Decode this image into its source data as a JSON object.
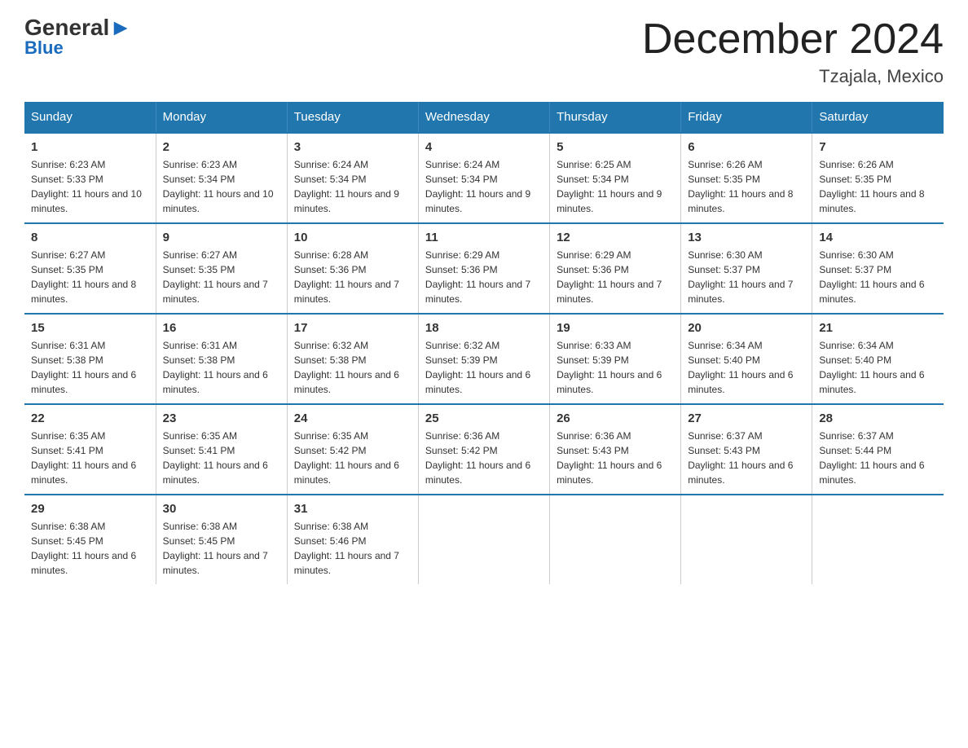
{
  "header": {
    "logo_general": "General",
    "logo_blue": "Blue",
    "title": "December 2024",
    "location": "Tzajala, Mexico"
  },
  "days_of_week": [
    "Sunday",
    "Monday",
    "Tuesday",
    "Wednesday",
    "Thursday",
    "Friday",
    "Saturday"
  ],
  "weeks": [
    [
      {
        "day": "1",
        "sunrise": "6:23 AM",
        "sunset": "5:33 PM",
        "daylight": "11 hours and 10 minutes."
      },
      {
        "day": "2",
        "sunrise": "6:23 AM",
        "sunset": "5:34 PM",
        "daylight": "11 hours and 10 minutes."
      },
      {
        "day": "3",
        "sunrise": "6:24 AM",
        "sunset": "5:34 PM",
        "daylight": "11 hours and 9 minutes."
      },
      {
        "day": "4",
        "sunrise": "6:24 AM",
        "sunset": "5:34 PM",
        "daylight": "11 hours and 9 minutes."
      },
      {
        "day": "5",
        "sunrise": "6:25 AM",
        "sunset": "5:34 PM",
        "daylight": "11 hours and 9 minutes."
      },
      {
        "day": "6",
        "sunrise": "6:26 AM",
        "sunset": "5:35 PM",
        "daylight": "11 hours and 8 minutes."
      },
      {
        "day": "7",
        "sunrise": "6:26 AM",
        "sunset": "5:35 PM",
        "daylight": "11 hours and 8 minutes."
      }
    ],
    [
      {
        "day": "8",
        "sunrise": "6:27 AM",
        "sunset": "5:35 PM",
        "daylight": "11 hours and 8 minutes."
      },
      {
        "day": "9",
        "sunrise": "6:27 AM",
        "sunset": "5:35 PM",
        "daylight": "11 hours and 7 minutes."
      },
      {
        "day": "10",
        "sunrise": "6:28 AM",
        "sunset": "5:36 PM",
        "daylight": "11 hours and 7 minutes."
      },
      {
        "day": "11",
        "sunrise": "6:29 AM",
        "sunset": "5:36 PM",
        "daylight": "11 hours and 7 minutes."
      },
      {
        "day": "12",
        "sunrise": "6:29 AM",
        "sunset": "5:36 PM",
        "daylight": "11 hours and 7 minutes."
      },
      {
        "day": "13",
        "sunrise": "6:30 AM",
        "sunset": "5:37 PM",
        "daylight": "11 hours and 7 minutes."
      },
      {
        "day": "14",
        "sunrise": "6:30 AM",
        "sunset": "5:37 PM",
        "daylight": "11 hours and 6 minutes."
      }
    ],
    [
      {
        "day": "15",
        "sunrise": "6:31 AM",
        "sunset": "5:38 PM",
        "daylight": "11 hours and 6 minutes."
      },
      {
        "day": "16",
        "sunrise": "6:31 AM",
        "sunset": "5:38 PM",
        "daylight": "11 hours and 6 minutes."
      },
      {
        "day": "17",
        "sunrise": "6:32 AM",
        "sunset": "5:38 PM",
        "daylight": "11 hours and 6 minutes."
      },
      {
        "day": "18",
        "sunrise": "6:32 AM",
        "sunset": "5:39 PM",
        "daylight": "11 hours and 6 minutes."
      },
      {
        "day": "19",
        "sunrise": "6:33 AM",
        "sunset": "5:39 PM",
        "daylight": "11 hours and 6 minutes."
      },
      {
        "day": "20",
        "sunrise": "6:34 AM",
        "sunset": "5:40 PM",
        "daylight": "11 hours and 6 minutes."
      },
      {
        "day": "21",
        "sunrise": "6:34 AM",
        "sunset": "5:40 PM",
        "daylight": "11 hours and 6 minutes."
      }
    ],
    [
      {
        "day": "22",
        "sunrise": "6:35 AM",
        "sunset": "5:41 PM",
        "daylight": "11 hours and 6 minutes."
      },
      {
        "day": "23",
        "sunrise": "6:35 AM",
        "sunset": "5:41 PM",
        "daylight": "11 hours and 6 minutes."
      },
      {
        "day": "24",
        "sunrise": "6:35 AM",
        "sunset": "5:42 PM",
        "daylight": "11 hours and 6 minutes."
      },
      {
        "day": "25",
        "sunrise": "6:36 AM",
        "sunset": "5:42 PM",
        "daylight": "11 hours and 6 minutes."
      },
      {
        "day": "26",
        "sunrise": "6:36 AM",
        "sunset": "5:43 PM",
        "daylight": "11 hours and 6 minutes."
      },
      {
        "day": "27",
        "sunrise": "6:37 AM",
        "sunset": "5:43 PM",
        "daylight": "11 hours and 6 minutes."
      },
      {
        "day": "28",
        "sunrise": "6:37 AM",
        "sunset": "5:44 PM",
        "daylight": "11 hours and 6 minutes."
      }
    ],
    [
      {
        "day": "29",
        "sunrise": "6:38 AM",
        "sunset": "5:45 PM",
        "daylight": "11 hours and 6 minutes."
      },
      {
        "day": "30",
        "sunrise": "6:38 AM",
        "sunset": "5:45 PM",
        "daylight": "11 hours and 7 minutes."
      },
      {
        "day": "31",
        "sunrise": "6:38 AM",
        "sunset": "5:46 PM",
        "daylight": "11 hours and 7 minutes."
      },
      null,
      null,
      null,
      null
    ]
  ]
}
